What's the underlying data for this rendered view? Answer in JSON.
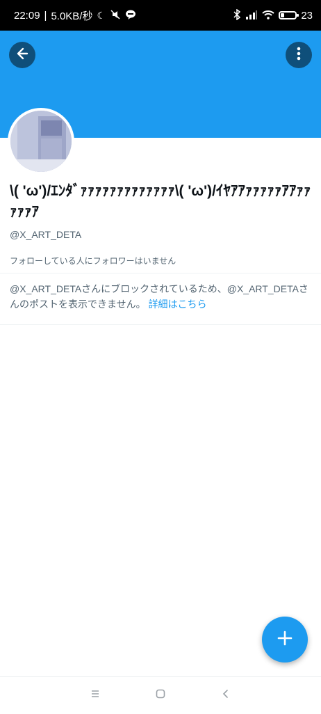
{
  "status_bar": {
    "time": "22:09",
    "network_speed": "5.0KB/秒",
    "battery_percent": "23"
  },
  "profile": {
    "display_name": "\\( 'ω')/ｴﾝﾀﾞｧｧｧｧｧｧｧｧｧｧｧｧｧ\\( 'ω')/ｲﾔｱｱｧｧｧｧｧｱｱｧｧｧｧｧｱ",
    "handle": "@X_ART_DETA",
    "followers_note": "フォローしている人にフォロワーはいません"
  },
  "blocked_notice": {
    "message": "@X_ART_DETAさんにブロックされているため、@X_ART_DETAさんのポストを表示できません。",
    "learn_more": "詳細はこちら"
  },
  "colors": {
    "accent": "#1d9bf0",
    "header_button": "#0f4f7a"
  },
  "icons": {
    "back": "arrow-left-icon",
    "more": "more-vertical-icon",
    "fab": "plus-icon",
    "nav_menu": "menu-icon",
    "nav_home": "home-square-icon",
    "nav_back": "chevron-left-icon"
  }
}
